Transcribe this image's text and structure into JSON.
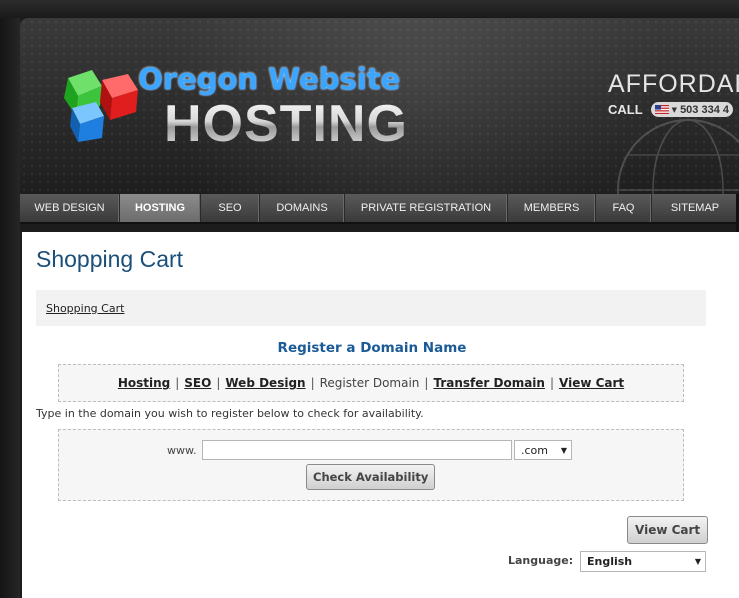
{
  "header": {
    "logo_top": "Oregon Website",
    "logo_bottom": "HOSTING",
    "tagline": "AFFORDABL",
    "call_label": "CALL",
    "phone_number": "503 334 4"
  },
  "nav": {
    "items": [
      {
        "label": "WEB DESIGN"
      },
      {
        "label": "HOSTING"
      },
      {
        "label": "SEO"
      },
      {
        "label": "DOMAINS"
      },
      {
        "label": "PRIVATE REGISTRATION"
      },
      {
        "label": "MEMBERS"
      },
      {
        "label": "FAQ"
      },
      {
        "label": "SITEMAP"
      }
    ],
    "active": "HOSTING"
  },
  "page": {
    "title": "Shopping Cart",
    "breadcrumb": "Shopping Cart",
    "section_title": "Register a Domain Name",
    "subnav": {
      "hosting": "Hosting",
      "seo": "SEO",
      "web_design": "Web Design",
      "register_domain": "Register Domain",
      "transfer_domain": "Transfer Domain",
      "view_cart": "View Cart",
      "separator": "|"
    },
    "instruction": "Type in the domain you wish to register below to check for availability.",
    "www_label": "www.",
    "domain_value": "",
    "tld_selected": ".com",
    "check_button": "Check Availability",
    "view_cart_button": "View Cart",
    "language_label": "Language:",
    "language_selected": "English"
  },
  "colors": {
    "title_blue": "#1a4f7a",
    "section_blue": "#1a5a96",
    "logo_blue": "#3ba6ff"
  }
}
